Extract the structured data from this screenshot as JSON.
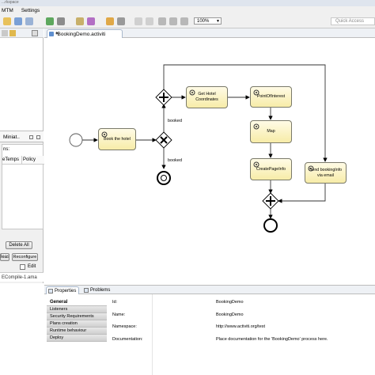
{
  "title_bar": {
    "text": "...rkspace"
  },
  "menu": [
    "MTM",
    "Settings"
  ],
  "toolbar": {
    "zoom": "100%",
    "quick_access": "Quick Access"
  },
  "left_panel": {
    "tab_label": "Miniat..",
    "list_label": "ns:",
    "columns": [
      "eTemps",
      "Policy"
    ],
    "delete_all": "Delete All",
    "release": "lease",
    "reconfigure": "Reconfigure",
    "edit": "Edit",
    "footer_text": "ECompile-1.ama"
  },
  "editor": {
    "tab_label": "*BookingDemo.activiti",
    "tasks": {
      "book_hotel": "Book the hotel",
      "get_hotel_coords": "Get Hotel\nCoordinates",
      "point_of_interest": "PointOfInterest",
      "map": "Map",
      "create_page_info": "CreatePageInfo",
      "send_booking_info": "Send bookingInfo\nvia email"
    },
    "flow_labels": {
      "booked_1": "booked",
      "booked_2": "booked"
    }
  },
  "properties": {
    "tabs": [
      "Properties",
      "Problems"
    ],
    "nav": [
      "General",
      "Listeners",
      "Security Requirements",
      "Plans creation",
      "Runtime behaviour",
      "Deploy"
    ],
    "fields": [
      {
        "label": "Id:",
        "value": "BookingDemo"
      },
      {
        "label": "Name:",
        "value": "BookingDemo"
      },
      {
        "label": "Namespace:",
        "value": "http://www.activiti.org/test"
      },
      {
        "label": "Documentation:",
        "value": "Place documentation for the 'BookingDemo' process here."
      }
    ]
  },
  "colors": {
    "task_fill": "#f7eca8",
    "accent": "#5f8fcf"
  }
}
